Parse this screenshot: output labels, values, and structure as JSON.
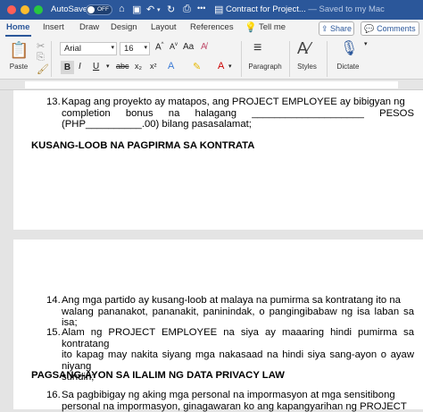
{
  "titlebar": {
    "autosave_label": "AutoSave",
    "autosave_state": "OFF",
    "doc_title": "Contract for Project...",
    "saved_status": "— Saved to my Mac"
  },
  "tabs": [
    "Home",
    "Insert",
    "Draw",
    "Design",
    "Layout",
    "References"
  ],
  "tell_me": "Tell me",
  "share_label": "Share",
  "comments_label": "Comments",
  "ribbon": {
    "paste_label": "Paste",
    "font_name": "Arial",
    "font_size": "16",
    "bold": "B",
    "italic": "I",
    "underline": "U",
    "paragraph_label": "Paragraph",
    "styles_label": "Styles",
    "dictate_label": "Dictate"
  },
  "page1": {
    "item13": {
      "number": "13.",
      "text_line1": "Kapag ang proyekto ay matapos, ang PROJECT EMPLOYEE ay bibigyan ng",
      "text_line2": "completion bonus na halagang ____________________ PESOS",
      "text_line3": "(PHP__________.00) bilang pasasalamat;"
    },
    "heading": "KUSANG-LOOB NA PAGPIRMA SA KONTRATA"
  },
  "page2": {
    "item14": {
      "number": "14.",
      "text_line1": "Ang mga partido ay kusang-loob at malaya na pumirma sa kontratang ito na",
      "text_line2": "walang pananakot, pananakit, paninindak, o pangingibabaw ng isa laban sa isa;"
    },
    "item15": {
      "number": "15.",
      "text_line1": "Alam ng PROJECT EMPLOYEE na siya ay maaaring hindi pumirma sa kontratang",
      "text_line2": "ito kapag may nakita siyang mga nakasaad na hindi siya sang-ayon o ayaw niyang",
      "text_line3": "sundin;"
    },
    "heading": "PAGSANG-AYON SA ILALIM NG DATA PRIVACY LAW",
    "item16": {
      "number": "16.",
      "text_line1": "Sa pagbibigay ng aking mga personal na impormasyon at mga sensitibong",
      "text_line2": "personal na impormasyon, ginagawaran ko ang kapangyarihan ng PROJECT"
    }
  },
  "colors": {
    "title_bar": "#2b579a",
    "spell_underline": "#d93025",
    "grammar_underline": "#3b6fd6"
  }
}
